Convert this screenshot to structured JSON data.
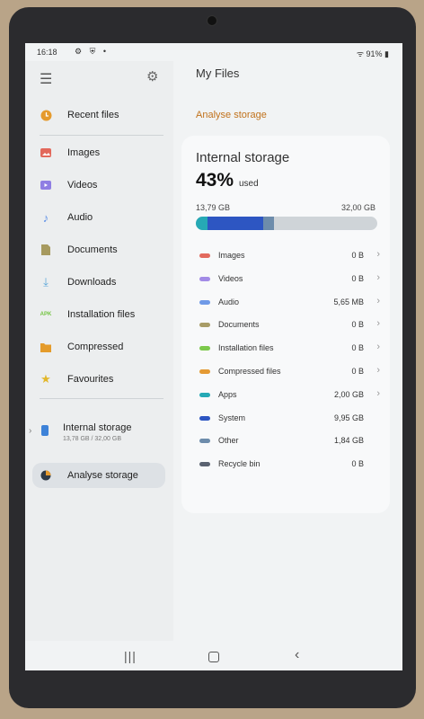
{
  "status": {
    "time": "16:18",
    "icons": "⚙ ⛨ •",
    "battery": "91%"
  },
  "sidebar": {
    "items": [
      {
        "label": "Recent files",
        "icon": "clock-icon",
        "color": "#e59a2d"
      },
      {
        "label": "Images",
        "icon": "image-icon",
        "color": "#e2685b"
      },
      {
        "label": "Videos",
        "icon": "video-icon",
        "color": "#8f7ee3"
      },
      {
        "label": "Audio",
        "icon": "music-icon",
        "color": "#5b8ee6"
      },
      {
        "label": "Documents",
        "icon": "document-icon",
        "color": "#a79a5f"
      },
      {
        "label": "Downloads",
        "icon": "download-icon",
        "color": "#5ba5d9"
      },
      {
        "label": "Installation files",
        "icon": "apk-icon",
        "color": "#74c443"
      },
      {
        "label": "Compressed",
        "icon": "folder-icon",
        "color": "#e49b2b"
      },
      {
        "label": "Favourites",
        "icon": "star-icon",
        "color": "#e2b72a"
      }
    ],
    "storage": {
      "name": "Internal storage",
      "detail": "13,78 GB / 32,00 GB"
    },
    "analyse": "Analyse storage"
  },
  "main": {
    "title": "My Files",
    "section": "Analyse storage",
    "card": {
      "title": "Internal storage",
      "percent": "43%",
      "used_word": "used",
      "used": "13,79 GB",
      "total": "32,00 GB",
      "used_fraction": 0.43
    },
    "categories": [
      {
        "name": "Images",
        "size": "0 B",
        "color": "#e26a5e",
        "chevron": true
      },
      {
        "name": "Videos",
        "size": "0 B",
        "color": "#a28be6",
        "chevron": true
      },
      {
        "name": "Audio",
        "size": "5,65 MB",
        "color": "#6f9ae7",
        "chevron": true
      },
      {
        "name": "Documents",
        "size": "0 B",
        "color": "#a89c67",
        "chevron": true
      },
      {
        "name": "Installation files",
        "size": "0 B",
        "color": "#7cc94c",
        "chevron": true
      },
      {
        "name": "Compressed files",
        "size": "0 B",
        "color": "#e49a34",
        "chevron": true
      },
      {
        "name": "Apps",
        "size": "2,00 GB",
        "color": "#26a9b5",
        "chevron": true
      },
      {
        "name": "System",
        "size": "9,95 GB",
        "color": "#2d56c2",
        "chevron": false
      },
      {
        "name": "Other",
        "size": "1,84 GB",
        "color": "#6d8cab",
        "chevron": false
      },
      {
        "name": "Recycle bin",
        "size": "0 B",
        "color": "#5a6270",
        "chevron": false
      }
    ]
  }
}
